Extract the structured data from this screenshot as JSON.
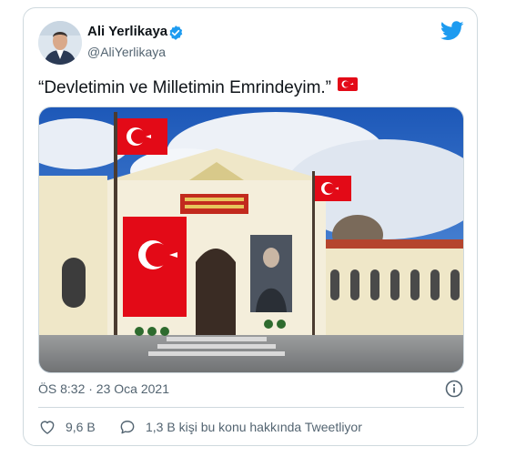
{
  "author": {
    "name": "Ali Yerlikaya",
    "handle": "@AliYerlikaya",
    "verified": true
  },
  "tweet": {
    "text": "“Devletimin ve Milletimin Emrindeyim.”",
    "emoji": "turkish-flag",
    "timestamp": "ÖS 8:32 · 23 Oca 2021"
  },
  "stats": {
    "likes": "9,6 B",
    "replies_text": "1,3 B kişi bu konu hakkında Tweetliyor"
  },
  "colors": {
    "brand": "#1d9bf0",
    "text": "#0f1419",
    "secondary": "#536471",
    "flag_red": "#e30a17"
  },
  "icons": [
    "twitter-bird-icon",
    "verified-badge-icon",
    "info-icon",
    "heart-icon",
    "reply-bubble-icon"
  ]
}
